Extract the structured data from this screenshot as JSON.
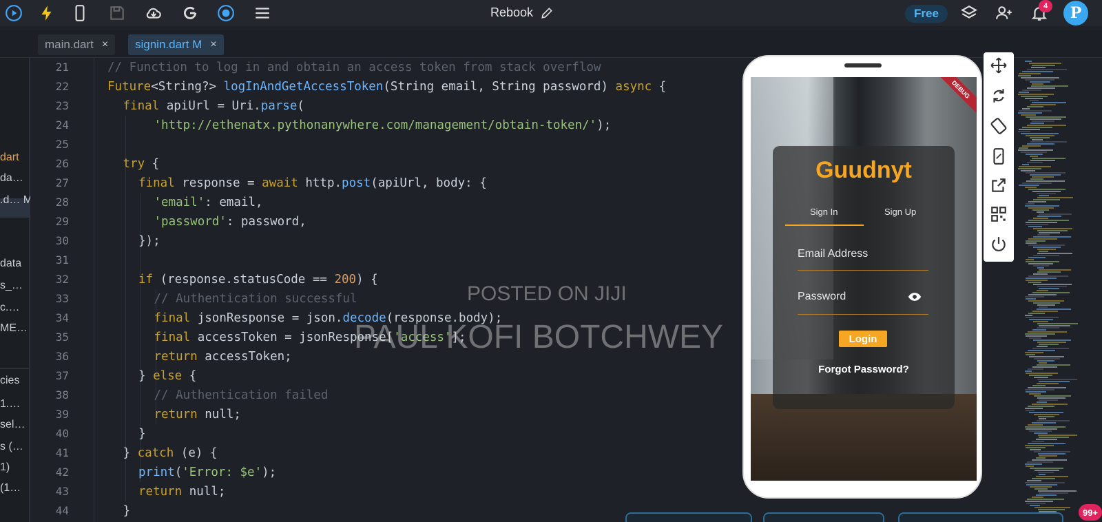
{
  "header": {
    "title": "Rebook",
    "free_label": "Free",
    "notification_count": "4",
    "avatar_letter": "P",
    "icons": [
      "play-circle-icon",
      "bolt-icon",
      "phone-icon",
      "save-icon",
      "cloud-download-icon",
      "google-icon",
      "target-icon",
      "menu-icon",
      "edit-icon",
      "layers-icon",
      "add-user-icon",
      "bell-icon"
    ]
  },
  "tabs": [
    {
      "label": "main.dart",
      "close": "×"
    },
    {
      "label": "signin.dart M",
      "close": "×"
    }
  ],
  "sidebar": {
    "items": [
      "dart",
      "da…",
      ".d… M",
      "data",
      "s_…",
      "c.…",
      "ME…",
      "cies",
      "1.…",
      "sel…",
      "s (…",
      "1)",
      "(1…"
    ]
  },
  "editor": {
    "line_numbers": [
      "21",
      "22",
      "23",
      "24",
      "25",
      "26",
      "27",
      "28",
      "29",
      "30",
      "31",
      "32",
      "33",
      "34",
      "35",
      "36",
      "37",
      "38",
      "39",
      "40",
      "41",
      "42",
      "43",
      "44"
    ],
    "lines": [
      {
        "comment": "// Function to log in and obtain an access token from stack overflow"
      },
      {
        "kw1": "Future",
        "t1": "<String?> ",
        "fn": "logInAndGetAccessToken",
        "t2": "(String email, String password) ",
        "kw2": "async",
        "t3": " {"
      },
      {
        "kw": "final",
        "t1": " apiUrl = Uri.",
        "fn": "parse",
        "t2": "("
      },
      {
        "str": "'http://ethenatx.pythonanywhere.com/management/obtain-token/'",
        "t1": ");"
      },
      {},
      {
        "kw": "try",
        "t1": " {"
      },
      {
        "kw": "final",
        "t1": " response = ",
        "kw2": "await",
        "t2": " http.",
        "fn": "post",
        "t3": "(apiUrl, body: {"
      },
      {
        "str": "'email'",
        "t1": ": email,"
      },
      {
        "str": "'password'",
        "t1": ": password,"
      },
      {
        "t1": "});"
      },
      {},
      {
        "kw": "if",
        "t1": " (response.statusCode == ",
        "num": "200",
        "t2": ") {"
      },
      {
        "comment": "// Authentication successful"
      },
      {
        "kw": "final",
        "t1": " jsonResponse = json.",
        "fn": "decode",
        "t2": "(response.body);"
      },
      {
        "kw": "final",
        "t1": " accessToken = jsonResponse[",
        "str": "'access'",
        "t2": "];"
      },
      {
        "kw": "return",
        "t1": " accessToken;"
      },
      {
        "t1": "} ",
        "kw": "else",
        "t2": " {"
      },
      {
        "comment": "// Authentication failed"
      },
      {
        "kw": "return",
        "t1": " null;"
      },
      {
        "t1": "}"
      },
      {
        "t1": "} ",
        "kw": "catch",
        "t2": " (e) {"
      },
      {
        "fn": "print",
        "t1": "(",
        "str": "'Error: $e'",
        "t2": ");"
      },
      {
        "kw": "return",
        "t1": " null;"
      },
      {
        "t1": "}"
      }
    ]
  },
  "watermark": {
    "line1": "POSTED ON JIJI",
    "line2": "PAUL KOFI BOTCHWEY"
  },
  "phone": {
    "debug_label": "DEBUG",
    "brand": "Guudnyt",
    "tab_signin": "Sign In",
    "tab_signup": "Sign Up",
    "email_placeholder": "Email Address",
    "password_placeholder": "Password",
    "login_label": "Login",
    "forgot_label": "Forgot Password?"
  },
  "device_toolbar": {
    "icons": [
      "move-icon",
      "rotate-icon",
      "screen-rotation-icon",
      "phone-outline-icon",
      "external-link-icon",
      "qr-code-icon",
      "power-icon"
    ]
  },
  "bottom": {
    "count": "99+"
  },
  "colors": {
    "accent": "#f5a623",
    "tab_active": "#58b6ff",
    "badge": "#e0245e"
  }
}
